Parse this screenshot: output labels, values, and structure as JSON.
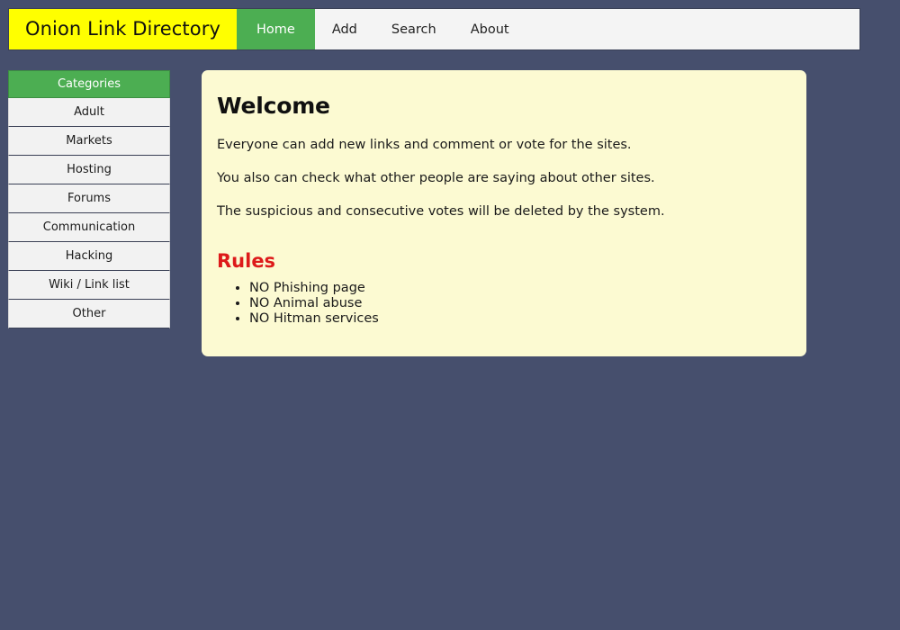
{
  "page": {
    "background_color": "#464f6d",
    "title": "Onion Link Directory"
  },
  "header": {
    "brand": "Onion Link Directory",
    "brand_bg": "#ffff00",
    "nav": [
      {
        "label": "Home",
        "active": true
      },
      {
        "label": "Add",
        "active": false
      },
      {
        "label": "Search",
        "active": false
      },
      {
        "label": "About",
        "active": false
      }
    ],
    "accent_color": "#4cae52"
  },
  "sidebar": {
    "header": "Categories",
    "items": [
      {
        "label": "Adult"
      },
      {
        "label": "Markets"
      },
      {
        "label": "Hosting"
      },
      {
        "label": "Forums"
      },
      {
        "label": "Communication"
      },
      {
        "label": "Hacking"
      },
      {
        "label": "Wiki / Link list"
      },
      {
        "label": "Other"
      }
    ]
  },
  "main": {
    "card_bg": "#fcfad2",
    "title": "Welcome",
    "paragraphs": [
      "Everyone can add new links and comment or vote for the sites.",
      "You also can check what other people are saying about other sites.",
      "The suspicious and consecutive votes will be deleted by the system."
    ],
    "rules": {
      "title": "Rules",
      "title_color": "#dd1a1a",
      "items": [
        "NO Phishing page",
        "NO Animal abuse",
        "NO Hitman services"
      ]
    }
  }
}
